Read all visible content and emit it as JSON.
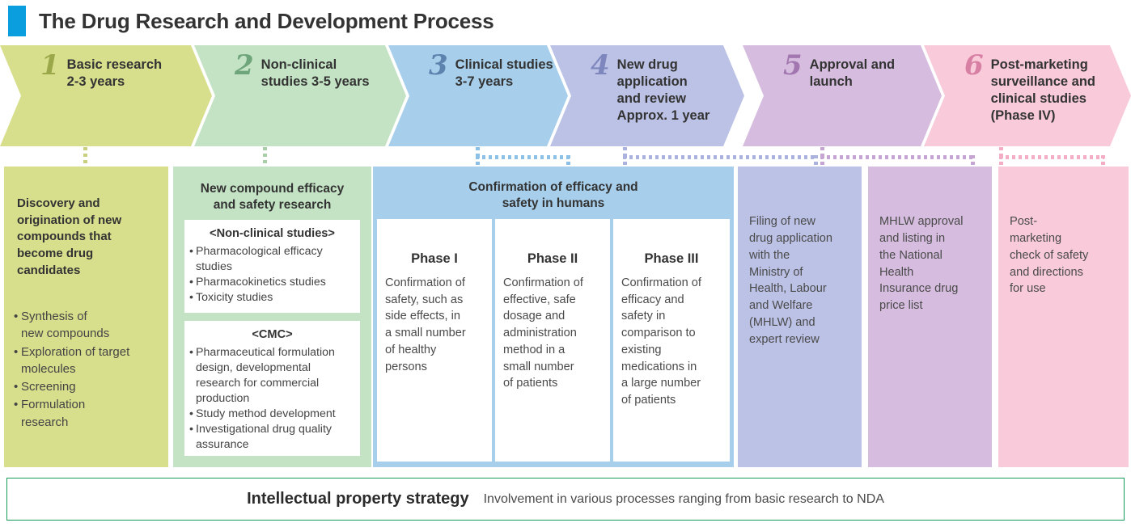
{
  "header": {
    "title": "The Drug Research and Development Process",
    "accent_color": "#0a9ede"
  },
  "stages": [
    {
      "number": "1",
      "label": "Basic research\n2-3 years",
      "fill": "#d7de8c",
      "num_color": "#9aa84a",
      "dot_color": "#c8d080"
    },
    {
      "number": "2",
      "label": "Non-clinical\nstudies 3-5 years",
      "fill": "#c4e3c4",
      "num_color": "#6fa57a",
      "dot_color": "#a8cfa8"
    },
    {
      "number": "3",
      "label": "Clinical studies\n3-7 years",
      "fill": "#a7cfec",
      "num_color": "#5c83ad",
      "dot_color": "#8dc0e6"
    },
    {
      "number": "4",
      "label": "New drug\napplication\nand review\nApprox. 1 year",
      "fill": "#bcc2e6",
      "num_color": "#7d86bd",
      "dot_color": "#aab2dd"
    },
    {
      "number": "5",
      "label": "Approval and\nlaunch",
      "fill": "#d6bddf",
      "num_color": "#a277b0",
      "dot_color": "#c6a5d2"
    },
    {
      "number": "6",
      "label": "Post-marketing\nsurveillance and\nclinical studies\n(Phase IV)",
      "fill": "#f8cada",
      "num_color": "#d880a3",
      "dot_color": "#f3aec6"
    }
  ],
  "columns": {
    "basic_research": {
      "fill": "#d7de8c",
      "heading": "Discovery and\norigination of new\ncompounds that\nbecome drug\ncandidates",
      "bullets": [
        "Synthesis of\nnew compounds",
        "Exploration of target\nmolecules",
        "Screening",
        "Formulation\nresearch"
      ]
    },
    "nonclinical": {
      "fill": "#c4e3c4",
      "heading": "New compound efficacy\nand safety research",
      "cards": [
        {
          "title": "<Non-clinical studies>",
          "bullets": [
            "Pharmacological efficacy\nstudies",
            "Pharmacokinetics studies",
            "Toxicity studies"
          ]
        },
        {
          "title": "<CMC>",
          "bullets": [
            "Pharmaceutical formulation\ndesign, developmental\nresearch for commercial\nproduction",
            "Study method development",
            "Investigational drug quality\nassurance"
          ]
        }
      ]
    },
    "clinical": {
      "fill": "#a7cfec",
      "heading": "Confirmation of efficacy and\nsafety in humans",
      "phases": [
        {
          "title": "Phase I",
          "body": "Confirmation of\nsafety, such as\nside effects, in\na small number\nof healthy\npersons"
        },
        {
          "title": "Phase II",
          "body": "Confirmation of\neffective, safe\ndosage and\nadministration\nmethod in a\nsmall number\nof patients"
        },
        {
          "title": "Phase III",
          "body": "Confirmation of\nefficacy and\nsafety in\ncomparison to\nexisting\nmedications in\na large number\nof patients"
        }
      ]
    },
    "application": {
      "fill": "#bcc2e6",
      "text": "Filing of new\ndrug application\nwith the\nMinistry of\nHealth, Labour\nand Welfare\n(MHLW) and\nexpert review"
    },
    "approval": {
      "fill": "#d6bddf",
      "text": "MHLW approval\nand listing in\nthe National\nHealth\nInsurance drug\nprice list"
    },
    "postmarketing": {
      "fill": "#f8cada",
      "text": "Post-\nmarketing\ncheck of safety\nand directions\nfor use"
    }
  },
  "footer": {
    "title": "Intellectual property strategy",
    "subtitle": "Involvement in various processes ranging from basic research to NDA",
    "border_color": "#159b5a"
  }
}
